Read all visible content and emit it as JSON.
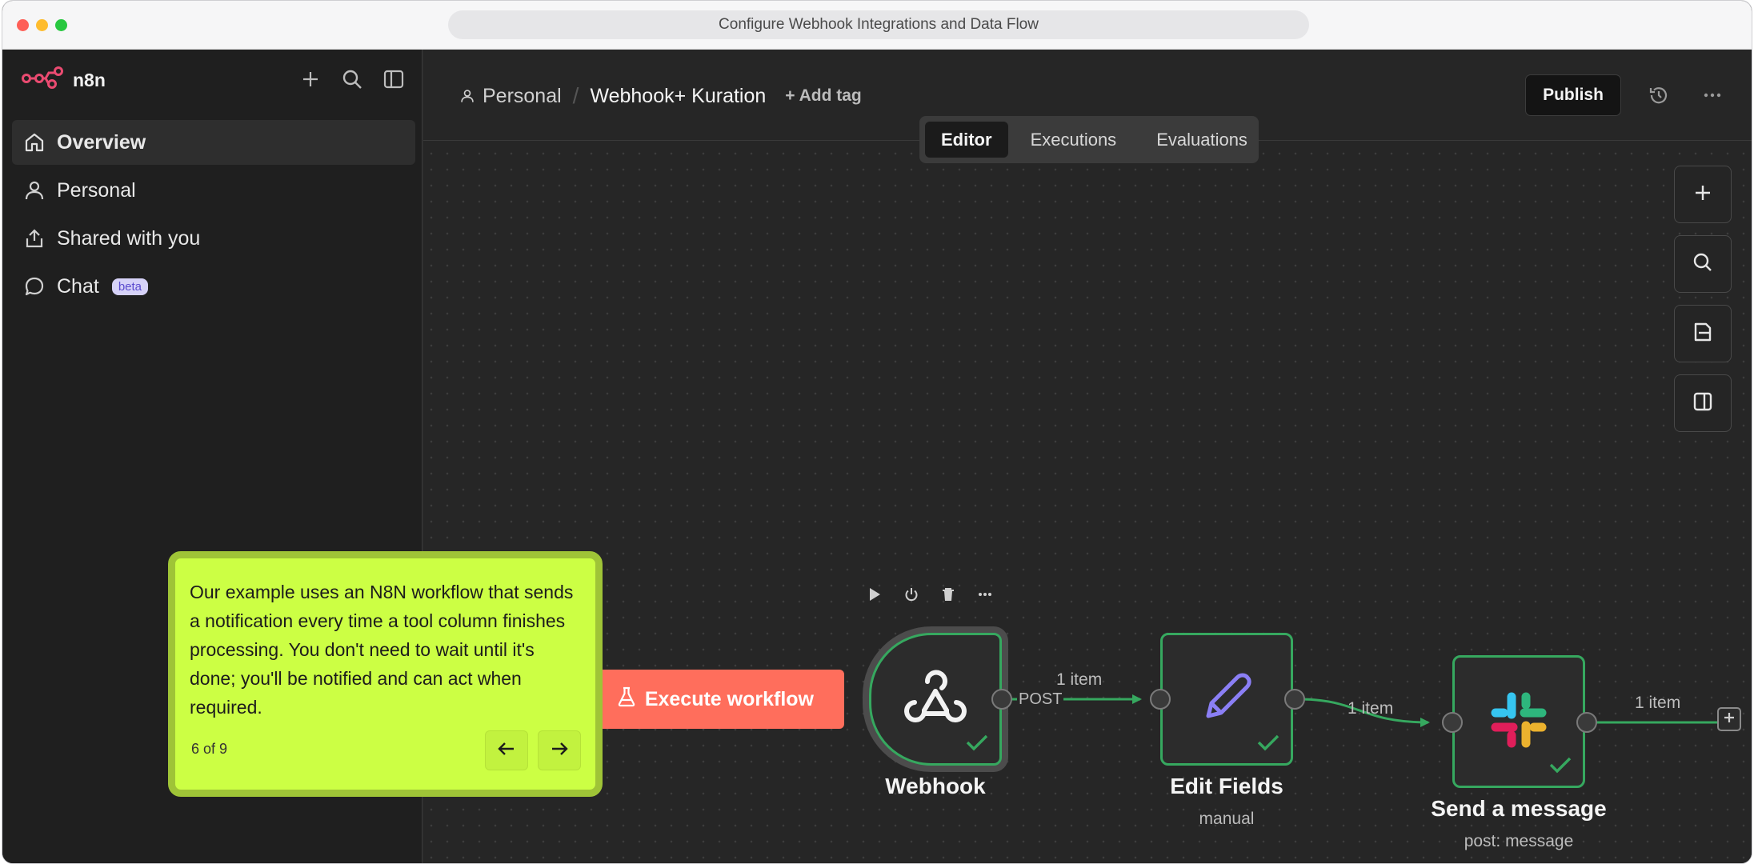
{
  "window": {
    "title": "Configure Webhook Integrations and Data Flow"
  },
  "sidebar": {
    "brand": "n8n",
    "items": [
      {
        "label": "Overview",
        "icon": "home-icon",
        "active": true
      },
      {
        "label": "Personal",
        "icon": "user-icon"
      },
      {
        "label": "Shared with you",
        "icon": "share-icon"
      },
      {
        "label": "Chat",
        "icon": "chat-icon",
        "badge": "beta"
      }
    ]
  },
  "header": {
    "project": "Personal",
    "workflow_name": "Webhook+ Kuration",
    "add_tag": "+ Add tag",
    "publish": "Publish"
  },
  "tabs": [
    {
      "label": "Editor",
      "active": true
    },
    {
      "label": "Executions"
    },
    {
      "label": "Evaluations"
    }
  ],
  "workflow": {
    "execute_label": "Execute workflow",
    "nodes": [
      {
        "name": "Webhook",
        "subtitle": ""
      },
      {
        "name": "Edit Fields",
        "subtitle": "manual"
      },
      {
        "name": "Send a message",
        "subtitle": "post: message"
      }
    ],
    "edges": [
      {
        "label": "1 item",
        "branch": "POST"
      },
      {
        "label": "1 item"
      },
      {
        "label": "1 item"
      }
    ]
  },
  "tour": {
    "text": "Our example uses an N8N workflow that sends a notification every time a tool column finishes processing. You don't need to wait until it's done; you'll be notified and can act when required.",
    "step": "6 of 9"
  },
  "colors": {
    "accent": "#ff6e5c",
    "success": "#36a85f",
    "tour_bg": "#ccff44",
    "edit_icon": "#8b7ff5"
  }
}
